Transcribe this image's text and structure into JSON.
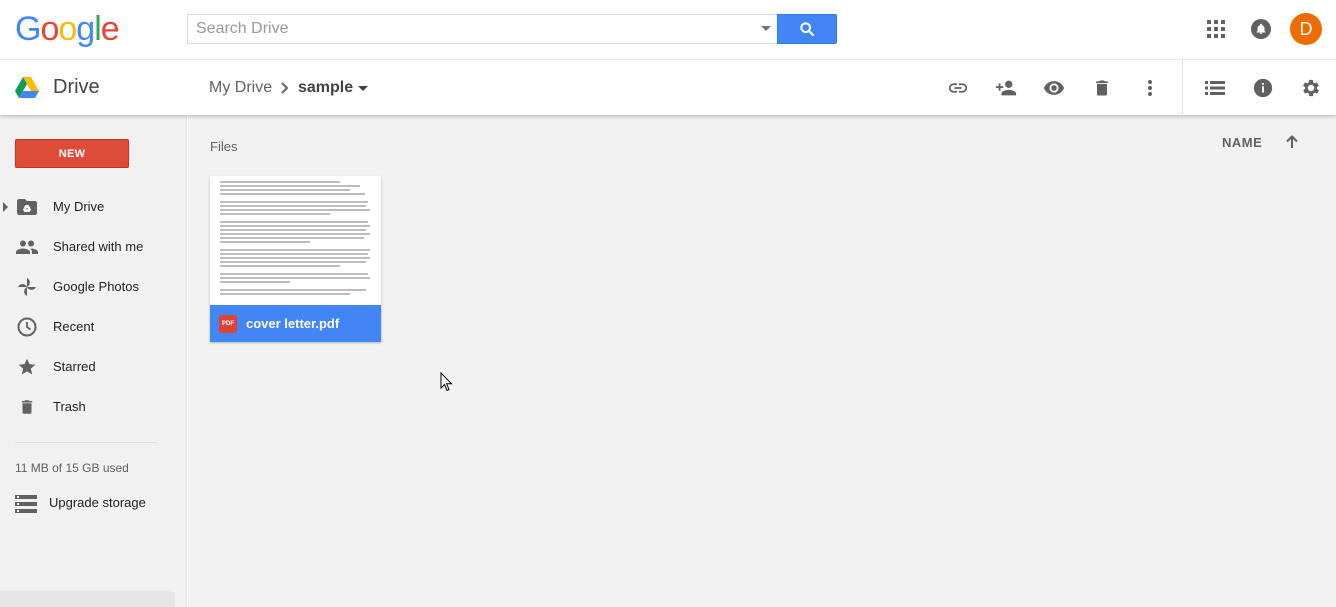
{
  "header": {
    "logo_letters": [
      {
        "ch": "G",
        "color": "#4285f4"
      },
      {
        "ch": "o",
        "color": "#ea4335"
      },
      {
        "ch": "o",
        "color": "#fbbc05"
      },
      {
        "ch": "g",
        "color": "#4285f4"
      },
      {
        "ch": "l",
        "color": "#34a853"
      },
      {
        "ch": "e",
        "color": "#ea4335"
      }
    ],
    "search_placeholder": "Search Drive",
    "search_icon": "search-icon",
    "apps_icon": "apps-grid-icon",
    "notifications_icon": "notifications-bell-icon",
    "avatar_initial": "D",
    "avatar_color": "#ef6c00"
  },
  "subbar": {
    "app_title": "Drive",
    "breadcrumb_root": "My Drive",
    "breadcrumb_current": "sample",
    "actions": [
      {
        "name": "get-link-icon"
      },
      {
        "name": "share-person-add-icon"
      },
      {
        "name": "preview-eye-icon"
      },
      {
        "name": "trash-icon"
      },
      {
        "name": "more-vert-icon"
      },
      {
        "name": "list-view-icon"
      },
      {
        "name": "info-icon"
      },
      {
        "name": "settings-gear-icon"
      }
    ]
  },
  "sidebar": {
    "new_button": "NEW",
    "new_button_color": "#dd4b39",
    "items": [
      {
        "label": "My Drive",
        "icon": "my-drive-folder-icon"
      },
      {
        "label": "Shared with me",
        "icon": "people-icon"
      },
      {
        "label": "Google Photos",
        "icon": "pinwheel-photos-icon"
      },
      {
        "label": "Recent",
        "icon": "clock-icon"
      },
      {
        "label": "Starred",
        "icon": "star-icon"
      },
      {
        "label": "Trash",
        "icon": "trash-icon"
      }
    ],
    "storage_text": "11 MB of 15 GB used",
    "upgrade_label": "Upgrade storage"
  },
  "main": {
    "files_heading": "Files",
    "sort_label": "NAME",
    "sort_icon": "arrow-up-icon",
    "files": [
      {
        "name": "cover letter.pdf",
        "type_badge": "PDF",
        "icon": "pdf-file-icon",
        "selected_color": "#4285f4"
      }
    ]
  }
}
